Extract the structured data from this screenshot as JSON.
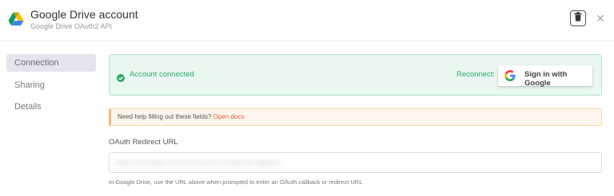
{
  "header": {
    "title": "Google Drive account",
    "subtitle": "Google Drive OAuth2 API"
  },
  "sidebar": {
    "items": [
      {
        "label": "Connection",
        "active": true
      },
      {
        "label": "Sharing",
        "active": false
      },
      {
        "label": "Details",
        "active": false
      }
    ]
  },
  "status": {
    "text": "Account connected",
    "reconnect_label": "Reconnect:",
    "sign_in_button": "Sign in with Google"
  },
  "help": {
    "text": "Need help filling out these fields?",
    "link": "Open docs"
  },
  "oauth": {
    "label": "OAuth Redirect URL",
    "value": "https://example.com/rest/oauth2-credential/callback",
    "hint": "In Google Drive, use the URL above when prompted to enter an OAuth callback or redirect URL"
  },
  "colors": {
    "success": "#2fa86a",
    "success_bg": "#e8f7ef",
    "link": "#e8553e",
    "warning_bg": "#fef6ec",
    "active_nav_bg": "#e4e4ec"
  },
  "icons": [
    "google-drive-logo-icon",
    "trash-icon",
    "close-icon",
    "check-circle-icon",
    "google-g-icon"
  ]
}
